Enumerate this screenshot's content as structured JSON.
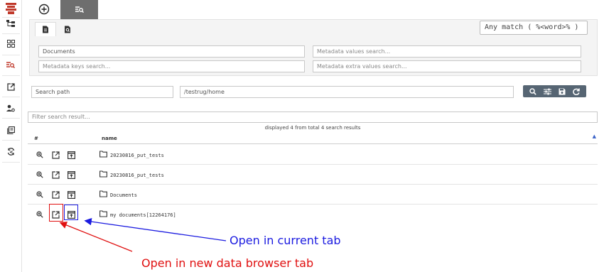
{
  "search": {
    "match_mode": "Any match ( %<word>% )",
    "documents_field": "Documents",
    "metadata_values_placeholder": "Metadata values search...",
    "metadata_keys_placeholder": "Metadata keys search...",
    "metadata_extra_placeholder": "Metadata extra values search...",
    "path_label": "Search path",
    "path_value": "/testrug/home"
  },
  "results": {
    "filter_placeholder": "Filter search result...",
    "summary": "displayed 4 from total 4 search results",
    "columns": [
      "#",
      "name"
    ],
    "rows": [
      {
        "name": "20230816_put_tests"
      },
      {
        "name": "20230816_put_tests"
      },
      {
        "name": "Documents"
      },
      {
        "name": "my documents[12264176]"
      }
    ]
  },
  "annotations": {
    "current_tab": "Open in current tab",
    "new_tab": "Open in new data browser tab",
    "current_tab_color": "#1a1ae0",
    "new_tab_color": "#e01010"
  },
  "icons": {
    "rail": [
      "tree-icon",
      "grid-icon",
      "search-list-icon",
      "open-external-icon",
      "user-settings-icon",
      "library-icon",
      "sync-icon"
    ],
    "row_actions": [
      "zoom-icon",
      "open-new-tab-icon",
      "open-current-tab-icon"
    ]
  }
}
